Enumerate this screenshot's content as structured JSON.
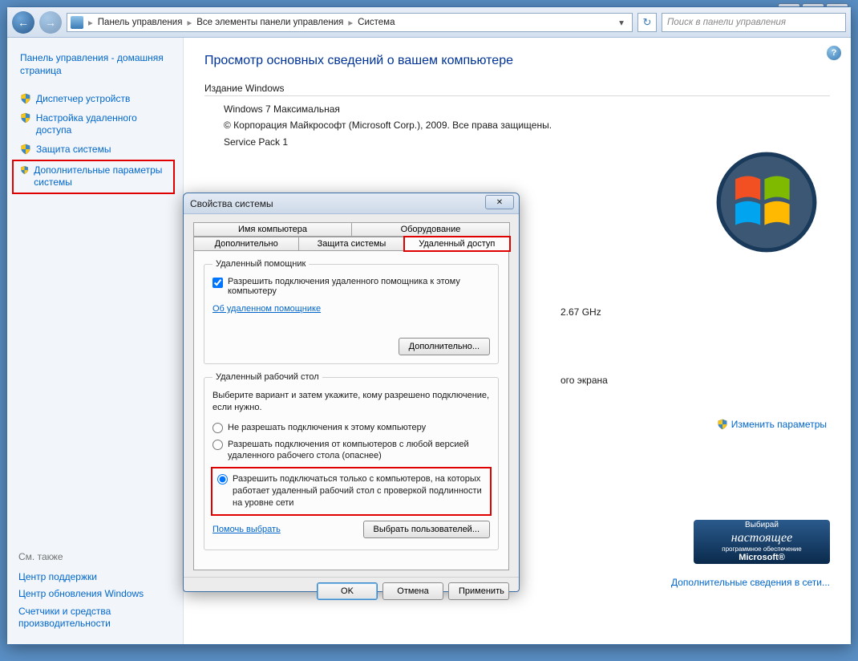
{
  "titlebar": {
    "min": "—",
    "max": "□",
    "close": "✕"
  },
  "nav": {
    "back": "←",
    "forward": "→",
    "refresh": "↻"
  },
  "breadcrumbs": {
    "items": [
      "Панель управления",
      "Все элементы панели управления",
      "Система"
    ],
    "sep": "▸"
  },
  "search": {
    "placeholder": "Поиск в панели управления"
  },
  "help_icon": "?",
  "sidebar": {
    "home": "Панель управления - домашняя страница",
    "links": [
      {
        "label": "Диспетчер устройств",
        "shield": true
      },
      {
        "label": "Настройка удаленного доступа",
        "shield": true
      },
      {
        "label": "Защита системы",
        "shield": true
      },
      {
        "label": "Дополнительные параметры системы",
        "shield": true,
        "highlight": true
      }
    ],
    "see_also_heading": "См. также",
    "see_also": [
      "Центр поддержки",
      "Центр обновления Windows",
      "Счетчики и средства производительности"
    ]
  },
  "page": {
    "title": "Просмотр основных сведений о вашем компьютере",
    "edition_heading": "Издание Windows",
    "edition_name": "Windows 7 Максимальная",
    "copyright": "© Корпорация Майкрософт (Microsoft Corp.), 2009. Все права защищены.",
    "service_pack": "Service Pack 1",
    "cpu_freq": "2.67 GHz",
    "screen_text": "ого экрана",
    "change_link": "Изменить параметры",
    "genuine": {
      "small1": "Выбирай",
      "big": "настоящее",
      "small2": "программное обеспечение",
      "brand": "Microsoft®"
    },
    "bottom_link": "Дополнительные сведения в сети..."
  },
  "dialog": {
    "title": "Свойства системы",
    "close": "✕",
    "tabs_row1": [
      "Имя компьютера",
      "Оборудование"
    ],
    "tabs_row2": [
      "Дополнительно",
      "Защита системы",
      "Удаленный доступ"
    ],
    "ra_group": "Удаленный помощник",
    "ra_check": "Разрешить подключения удаленного помощника к этому компьютеру",
    "ra_link": "Об удаленном помощнике",
    "ra_advanced": "Дополнительно...",
    "rd_group": "Удаленный рабочий стол",
    "rd_text": "Выберите вариант и затем укажите, кому разрешено подключение, если нужно.",
    "rd_radio1": "Не разрешать подключения к этому компьютеру",
    "rd_radio2": "Разрешать подключения от компьютеров с любой версией удаленного рабочего стола (опаснее)",
    "rd_radio3": "Разрешить подключаться только с компьютеров, на которых работает удаленный рабочий стол с проверкой подлинности на уровне сети",
    "rd_help": "Помочь выбрать",
    "rd_select_users": "Выбрать пользователей...",
    "buttons": {
      "ok": "OK",
      "cancel": "Отмена",
      "apply": "Применить"
    }
  }
}
